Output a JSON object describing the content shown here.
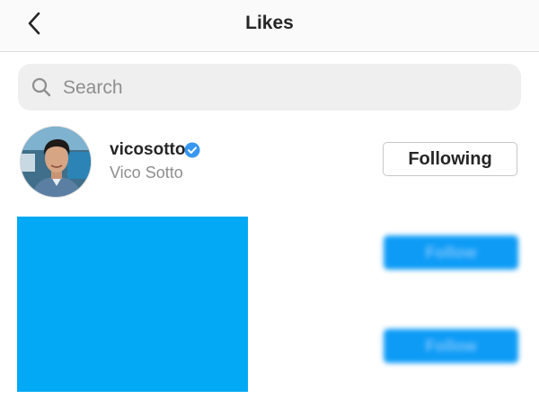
{
  "header": {
    "title": "Likes",
    "back_icon": "chevron-left-icon"
  },
  "search": {
    "placeholder": "Search",
    "icon": "search-icon"
  },
  "likes": [
    {
      "username": "vicosotto",
      "full_name": "Vico Sotto",
      "verified": true,
      "button_label": "Following"
    },
    {
      "button_label": "Follow"
    },
    {
      "button_label": "Follow"
    }
  ],
  "colors": {
    "verified_badge": "#3897f0",
    "follow_button": "#0d9bf6",
    "redaction": "#03a9f4"
  }
}
